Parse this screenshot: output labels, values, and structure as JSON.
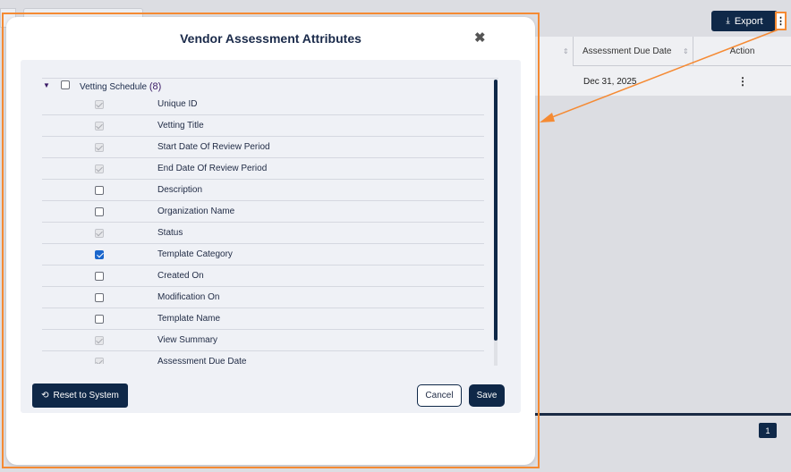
{
  "background": {
    "search_placeholder": "",
    "export_label": "Export",
    "export_icon": "download-icon",
    "table": {
      "headers": [
        "Assessment Due Date",
        "Action"
      ],
      "row": {
        "due_date": "Dec 31, 2025",
        "action_icon": "kebab-icon"
      }
    },
    "pagination": {
      "current_page": "1"
    }
  },
  "modal": {
    "title": "Vendor Assessment Attributes",
    "close_icon": "close-icon",
    "group": {
      "label": "Vetting Schedule",
      "count": "(8)",
      "expanded": true,
      "checked": false
    },
    "attributes": [
      {
        "label": "Unique ID",
        "state": "disabled"
      },
      {
        "label": "Vetting Title",
        "state": "disabled"
      },
      {
        "label": "Start Date Of Review Period",
        "state": "disabled"
      },
      {
        "label": "End Date Of Review Period",
        "state": "disabled"
      },
      {
        "label": "Description",
        "state": "unchecked"
      },
      {
        "label": "Organization Name",
        "state": "unchecked"
      },
      {
        "label": "Status",
        "state": "disabled"
      },
      {
        "label": "Template Category",
        "state": "checked"
      },
      {
        "label": "Created On",
        "state": "unchecked"
      },
      {
        "label": "Modification On",
        "state": "unchecked"
      },
      {
        "label": "Template Name",
        "state": "unchecked"
      },
      {
        "label": "View Summary",
        "state": "disabled"
      },
      {
        "label": "Assessment Due Date",
        "state": "disabled"
      }
    ],
    "buttons": {
      "reset": "Reset to System",
      "cancel": "Cancel",
      "save": "Save"
    }
  },
  "colors": {
    "primary": "#0f2848",
    "annotation": "#f58a33",
    "checked": "#1a66cc"
  }
}
